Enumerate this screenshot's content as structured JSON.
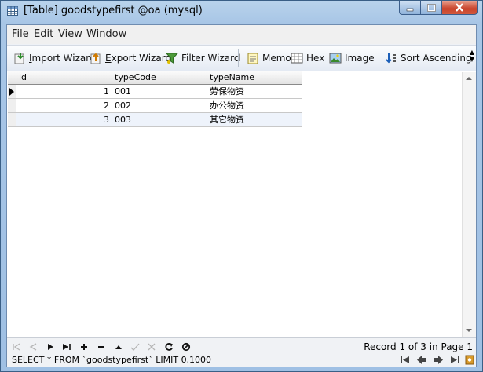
{
  "window": {
    "title": "[Table] goodstypefirst @oa (mysql)",
    "colors": {
      "accent": "#0054e3",
      "title_bg": "#b9d3ec",
      "close": "#c8432b"
    }
  },
  "menu": {
    "items": [
      {
        "label": "File",
        "accel": "F",
        "rest": "ile"
      },
      {
        "label": "Edit",
        "accel": "E",
        "rest": "dit"
      },
      {
        "label": "View",
        "accel": "V",
        "rest": "iew"
      },
      {
        "label": "Window",
        "accel": "W",
        "rest": "indow"
      }
    ]
  },
  "toolbar": {
    "import_wizard": {
      "accel": "I",
      "rest": "mport Wizard",
      "icon": "import-icon"
    },
    "export_wizard": {
      "accel": "E",
      "rest": "xport Wizard",
      "icon": "export-icon"
    },
    "filter_wizard": {
      "label": "Filter Wizard",
      "icon": "filter-icon"
    },
    "memo": {
      "label": "Memo",
      "icon": "memo-icon"
    },
    "hex": {
      "label": "Hex",
      "icon": "hex-icon"
    },
    "image": {
      "label": "Image",
      "icon": "image-icon"
    },
    "sort_ascending": {
      "label": "Sort Ascending",
      "icon": "sort-ascending-icon"
    }
  },
  "grid": {
    "columns": [
      "id",
      "typeCode",
      "typeName"
    ],
    "rows": [
      {
        "id": "1",
        "typeCode": "001",
        "typeName": "劳保物资"
      },
      {
        "id": "2",
        "typeCode": "002",
        "typeName": "办公物资"
      },
      {
        "id": "3",
        "typeCode": "003",
        "typeName": "其它物资"
      }
    ]
  },
  "navbar": {
    "record_status": "Record 1 of 3 in Page 1",
    "sql": "SELECT * FROM `goodstypefirst` LIMIT 0,1000"
  }
}
